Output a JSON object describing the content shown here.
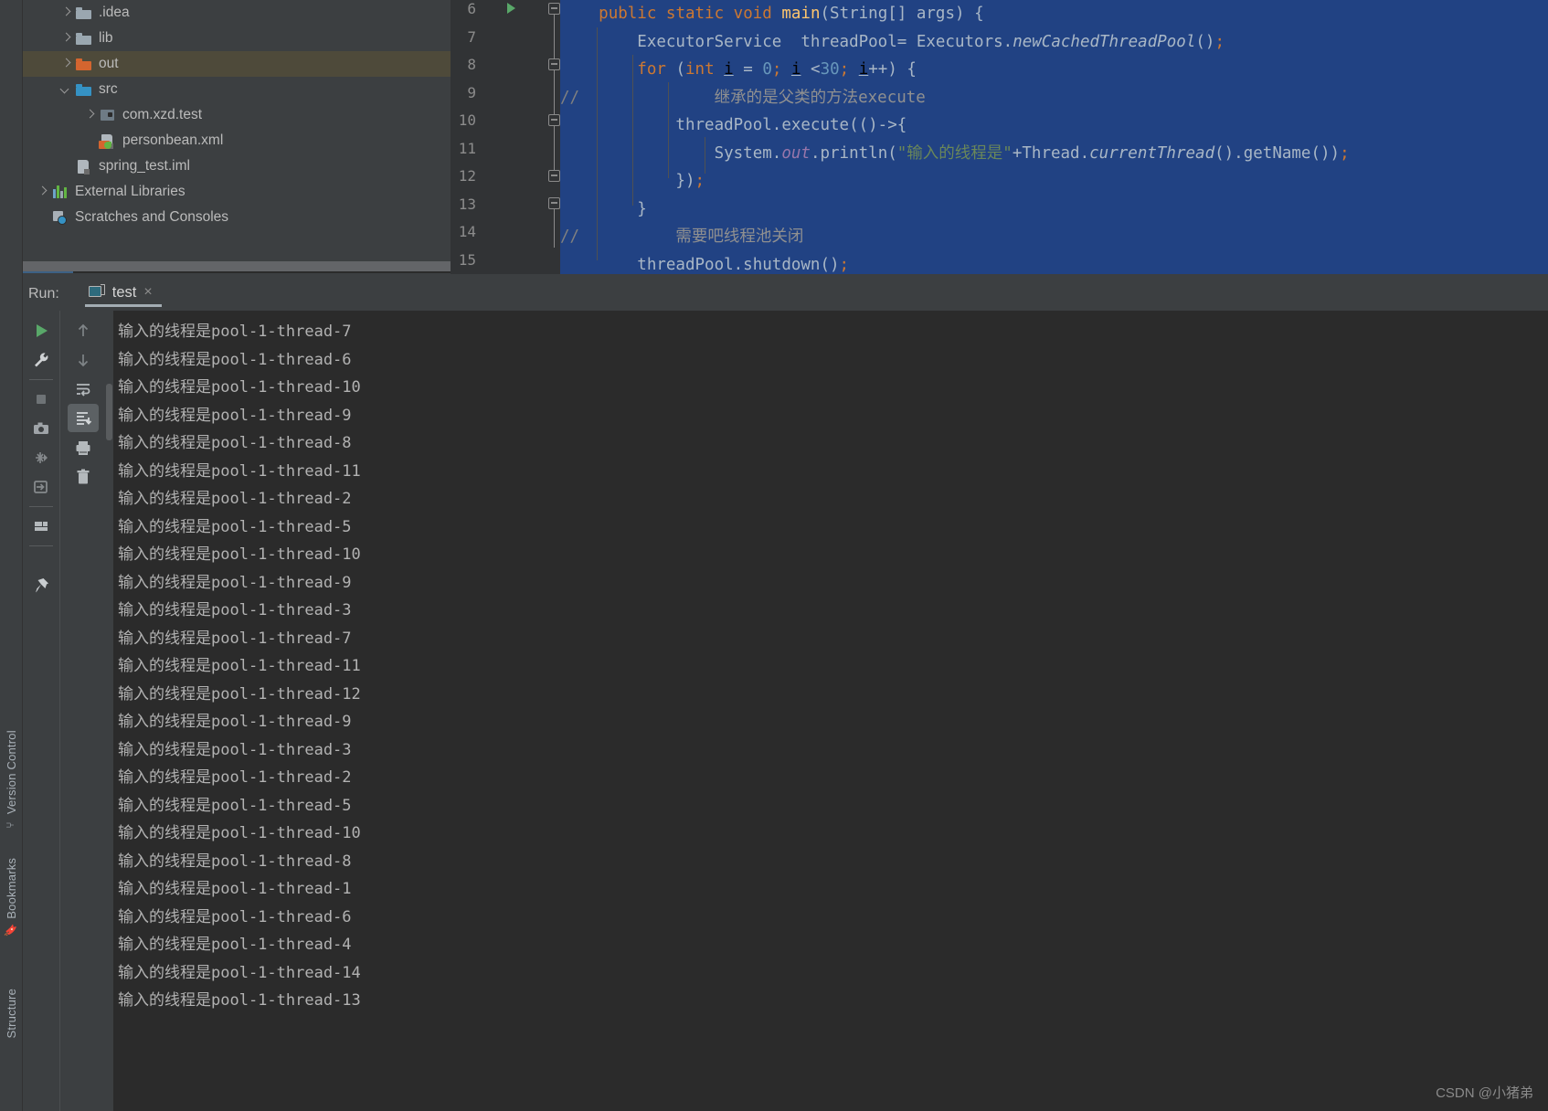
{
  "app": {
    "theme_bg": "#3c3f41",
    "editor_bg": "#2b2b2b",
    "selection_color": "#214283",
    "accent_green": "#59a869"
  },
  "tool_tabs_left": [
    {
      "label": "Version Control",
      "icon": "branch-icon"
    },
    {
      "label": "Bookmarks",
      "icon": "bookmark-icon"
    },
    {
      "label": "Structure",
      "icon": "structure-icon"
    }
  ],
  "project_tree": {
    "items": [
      {
        "label": ".idea",
        "arrow": "right",
        "icon": "folder-gray-icon",
        "indent": 1,
        "selected": false
      },
      {
        "label": "lib",
        "arrow": "right",
        "icon": "folder-gray-icon",
        "indent": 1,
        "selected": false
      },
      {
        "label": "out",
        "arrow": "right",
        "icon": "folder-orange-icon",
        "indent": 1,
        "selected": true
      },
      {
        "label": "src",
        "arrow": "down",
        "icon": "folder-blue-icon",
        "indent": 1,
        "selected": false
      },
      {
        "label": "com.xzd.test",
        "arrow": "right",
        "icon": "package-icon",
        "indent": 2,
        "selected": false
      },
      {
        "label": "personbean.xml",
        "arrow": "none",
        "icon": "xml-spring-file-icon",
        "indent": 2,
        "selected": false
      },
      {
        "label": "spring_test.iml",
        "arrow": "none",
        "icon": "iml-file-icon",
        "indent": 1,
        "selected": false
      },
      {
        "label": "External Libraries",
        "arrow": "right",
        "icon": "libraries-icon",
        "indent": 0,
        "selected": false
      },
      {
        "label": "Scratches and Consoles",
        "arrow": "none",
        "icon": "scratches-icon",
        "indent": 0,
        "selected": false
      }
    ]
  },
  "editor": {
    "line_numbers": [
      "6",
      "7",
      "8",
      "9",
      "10",
      "11",
      "12",
      "13",
      "14",
      "15"
    ],
    "lines": [
      {
        "n": "6",
        "text": "    public static void main(String[] args) {"
      },
      {
        "n": "7",
        "text": "        ExecutorService  threadPool= Executors.newCachedThreadPool();"
      },
      {
        "n": "8",
        "text": "        for (int i = 0; i <30; i++) {"
      },
      {
        "n": "9",
        "text": "//              继承的是父类的方法execute"
      },
      {
        "n": "10",
        "text": "            threadPool.execute(()->{"
      },
      {
        "n": "11",
        "text": "                System.out.println(\"输入的线程是\"+Thread.currentThread().getName());"
      },
      {
        "n": "12",
        "text": "            });"
      },
      {
        "n": "13",
        "text": "        }"
      },
      {
        "n": "14",
        "text": "//          需要吧线程池关闭"
      },
      {
        "n": "15",
        "text": "        threadPool.shutdown();"
      }
    ]
  },
  "run_panel": {
    "label": "Run:",
    "tab": {
      "label": "test",
      "close": "×",
      "icon": "run-config-icon"
    },
    "toolbar_primary": [
      {
        "name": "rerun-button",
        "icon": "play-icon"
      },
      {
        "name": "edit-configurations-button",
        "icon": "wrench-icon"
      },
      {
        "name": "stop-button",
        "icon": "stop-square-icon"
      },
      {
        "name": "screenshot-button",
        "icon": "camera-icon"
      },
      {
        "name": "dump-threads-button",
        "icon": "thread-dump-icon"
      },
      {
        "name": "resume-program-button",
        "icon": "resume-icon"
      },
      {
        "name": "layout-settings-button",
        "icon": "layout-icon"
      },
      {
        "name": "pin-tab-button",
        "icon": "pin-icon"
      }
    ],
    "toolbar_secondary": [
      {
        "name": "up-the-stack-trace-button",
        "icon": "arrow-up-icon"
      },
      {
        "name": "down-the-stack-trace-button",
        "icon": "arrow-down-icon"
      },
      {
        "name": "soft-wrap-button",
        "icon": "soft-wrap-icon"
      },
      {
        "name": "scroll-to-end-button",
        "icon": "scroll-to-end-icon",
        "active": true
      },
      {
        "name": "print-button",
        "icon": "printer-icon"
      },
      {
        "name": "clear-all-button",
        "icon": "trash-icon"
      }
    ],
    "console_lines": [
      "输入的线程是pool-1-thread-7",
      "输入的线程是pool-1-thread-6",
      "输入的线程是pool-1-thread-10",
      "输入的线程是pool-1-thread-9",
      "输入的线程是pool-1-thread-8",
      "输入的线程是pool-1-thread-11",
      "输入的线程是pool-1-thread-2",
      "输入的线程是pool-1-thread-5",
      "输入的线程是pool-1-thread-10",
      "输入的线程是pool-1-thread-9",
      "输入的线程是pool-1-thread-3",
      "输入的线程是pool-1-thread-7",
      "输入的线程是pool-1-thread-11",
      "输入的线程是pool-1-thread-12",
      "输入的线程是pool-1-thread-9",
      "输入的线程是pool-1-thread-3",
      "输入的线程是pool-1-thread-2",
      "输入的线程是pool-1-thread-5",
      "输入的线程是pool-1-thread-10",
      "输入的线程是pool-1-thread-8",
      "输入的线程是pool-1-thread-1",
      "输入的线程是pool-1-thread-6",
      "输入的线程是pool-1-thread-4",
      "输入的线程是pool-1-thread-14",
      "输入的线程是pool-1-thread-13"
    ]
  },
  "watermark": "CSDN @小猪弟"
}
